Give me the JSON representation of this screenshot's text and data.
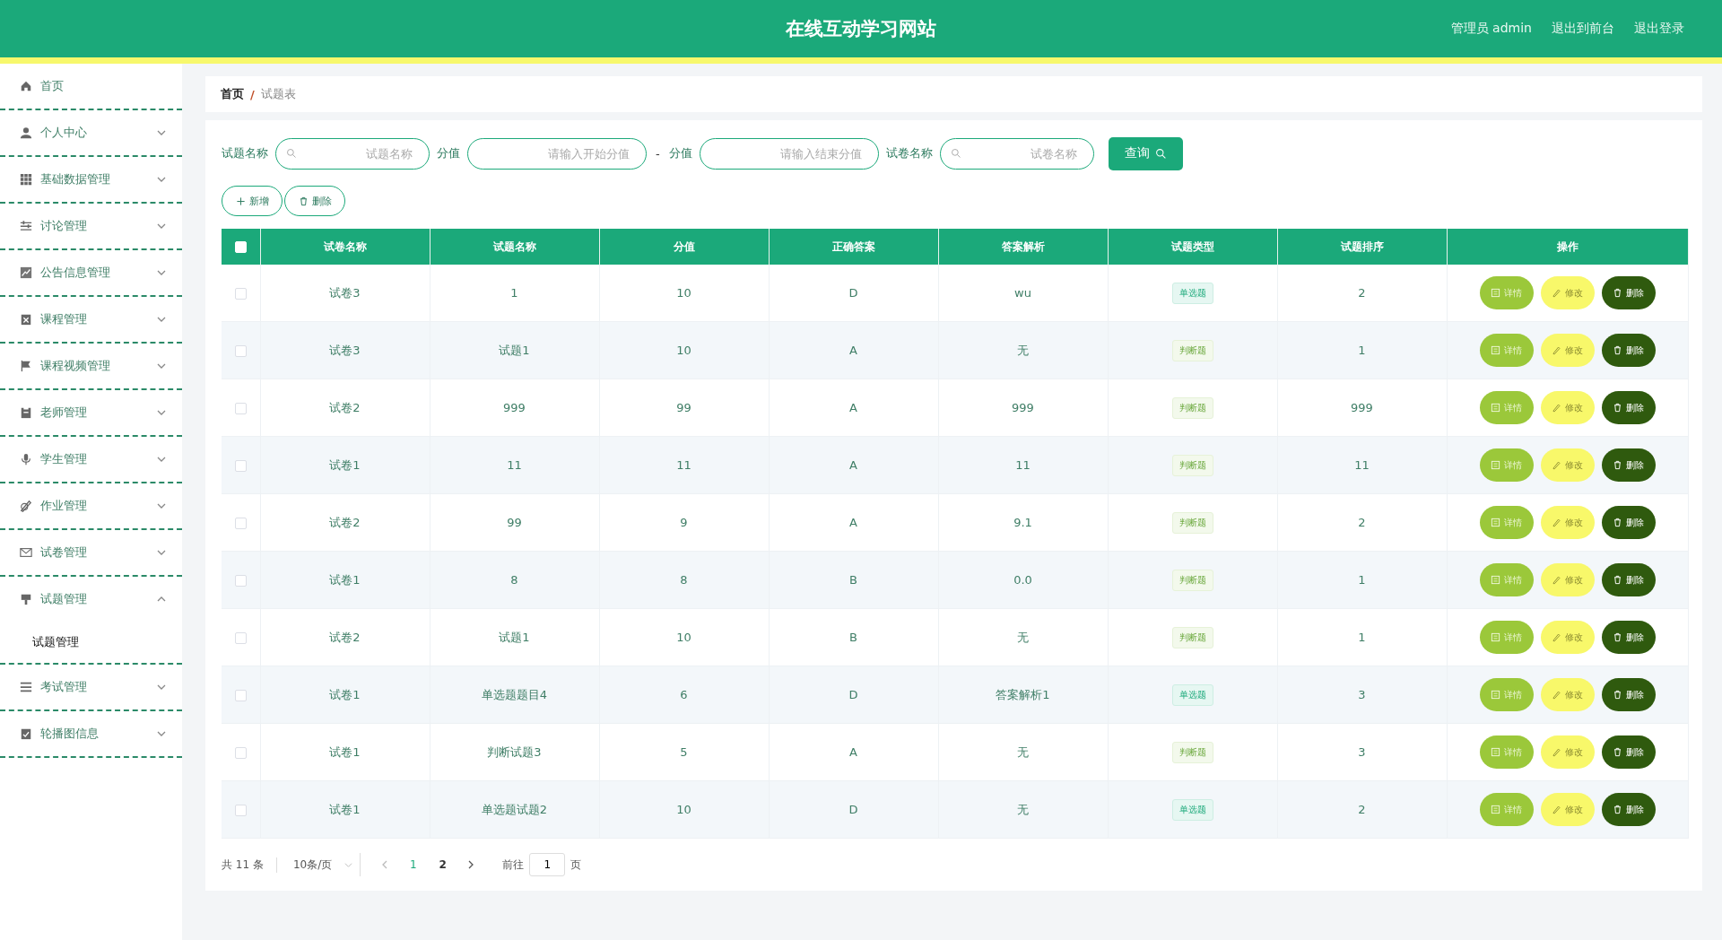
{
  "header": {
    "title": "在线互动学习网站",
    "links": [
      {
        "label": "管理员 admin"
      },
      {
        "label": "退出到前台"
      },
      {
        "label": "退出登录"
      }
    ]
  },
  "sidebar": {
    "items": [
      {
        "kind": "link",
        "label": "首页"
      },
      {
        "kind": "group",
        "label": "个人中心",
        "expanded": false
      },
      {
        "kind": "group",
        "label": "基础数据管理",
        "expanded": false
      },
      {
        "kind": "group",
        "label": "讨论管理",
        "expanded": false
      },
      {
        "kind": "group",
        "label": "公告信息管理",
        "expanded": false
      },
      {
        "kind": "group",
        "label": "课程管理",
        "expanded": false
      },
      {
        "kind": "group",
        "label": "课程视频管理",
        "expanded": false
      },
      {
        "kind": "group",
        "label": "老师管理",
        "expanded": false
      },
      {
        "kind": "group",
        "label": "学生管理",
        "expanded": false
      },
      {
        "kind": "group",
        "label": "作业管理",
        "expanded": false
      },
      {
        "kind": "group",
        "label": "试卷管理",
        "expanded": false
      },
      {
        "kind": "group",
        "label": "试题管理",
        "expanded": true,
        "children": [
          {
            "label": "试题管理",
            "selected": true
          }
        ]
      },
      {
        "kind": "group",
        "label": "考试管理",
        "expanded": false
      },
      {
        "kind": "group",
        "label": "轮播图信息",
        "expanded": false
      }
    ]
  },
  "breadcrumb": [
    {
      "label": "首页"
    },
    {
      "label": "试题表"
    }
  ],
  "breadcrumb_separator": "/",
  "filters": [
    {
      "kind": "search",
      "label": "试题名称",
      "placeholder": "试题名称"
    },
    {
      "kind": "plain",
      "label": "分值",
      "placeholder": "请输入开始分值"
    },
    {
      "kind": "dash",
      "label": "-"
    },
    {
      "kind": "plain",
      "label": "分值",
      "placeholder": "请输入结束分值"
    },
    {
      "kind": "search",
      "label": "试卷名称",
      "placeholder": "试卷名称"
    }
  ],
  "query_button": "查询",
  "toolbar": [
    {
      "kind": "add",
      "label": "新增"
    },
    {
      "kind": "delete",
      "label": "删除"
    }
  ],
  "table": {
    "header_checked": false,
    "columns": [
      "试卷名称",
      "试题名称",
      "分值",
      "正确答案",
      "答案解析",
      "试题类型",
      "试题排序",
      "操作"
    ],
    "rows": [
      {
        "checked": false,
        "cells": [
          "试卷3",
          "1",
          "10",
          "D",
          "wu"
        ],
        "type": {
          "kind": "single",
          "label": "单选题"
        },
        "order": "2",
        "actions": [
          {
            "kind": "detail",
            "label": "详情"
          },
          {
            "kind": "edit",
            "label": "修改"
          },
          {
            "kind": "delete",
            "label": "删除"
          }
        ]
      },
      {
        "checked": false,
        "cells": [
          "试卷3",
          "试题1",
          "10",
          "A",
          "无"
        ],
        "type": {
          "kind": "judge",
          "label": "判断题"
        },
        "order": "1",
        "actions": [
          {
            "kind": "detail",
            "label": "详情"
          },
          {
            "kind": "edit",
            "label": "修改"
          },
          {
            "kind": "delete",
            "label": "删除"
          }
        ]
      },
      {
        "checked": false,
        "cells": [
          "试卷2",
          "999",
          "99",
          "A",
          "999"
        ],
        "type": {
          "kind": "judge",
          "label": "判断题"
        },
        "order": "999",
        "actions": [
          {
            "kind": "detail",
            "label": "详情"
          },
          {
            "kind": "edit",
            "label": "修改"
          },
          {
            "kind": "delete",
            "label": "删除"
          }
        ]
      },
      {
        "checked": false,
        "cells": [
          "试卷1",
          "11",
          "11",
          "A",
          "11"
        ],
        "type": {
          "kind": "judge",
          "label": "判断题"
        },
        "order": "11",
        "actions": [
          {
            "kind": "detail",
            "label": "详情"
          },
          {
            "kind": "edit",
            "label": "修改"
          },
          {
            "kind": "delete",
            "label": "删除"
          }
        ]
      },
      {
        "checked": false,
        "cells": [
          "试卷2",
          "99",
          "9",
          "A",
          "9.1"
        ],
        "type": {
          "kind": "judge",
          "label": "判断题"
        },
        "order": "2",
        "actions": [
          {
            "kind": "detail",
            "label": "详情"
          },
          {
            "kind": "edit",
            "label": "修改"
          },
          {
            "kind": "delete",
            "label": "删除"
          }
        ]
      },
      {
        "checked": false,
        "cells": [
          "试卷1",
          "8",
          "8",
          "B",
          "0.0"
        ],
        "type": {
          "kind": "judge",
          "label": "判断题"
        },
        "order": "1",
        "actions": [
          {
            "kind": "detail",
            "label": "详情"
          },
          {
            "kind": "edit",
            "label": "修改"
          },
          {
            "kind": "delete",
            "label": "删除"
          }
        ]
      },
      {
        "checked": false,
        "cells": [
          "试卷2",
          "试题1",
          "10",
          "B",
          "无"
        ],
        "type": {
          "kind": "judge",
          "label": "判断题"
        },
        "order": "1",
        "actions": [
          {
            "kind": "detail",
            "label": "详情"
          },
          {
            "kind": "edit",
            "label": "修改"
          },
          {
            "kind": "delete",
            "label": "删除"
          }
        ]
      },
      {
        "checked": false,
        "cells": [
          "试卷1",
          "单选题题目4",
          "6",
          "D",
          "答案解析1"
        ],
        "type": {
          "kind": "single",
          "label": "单选题"
        },
        "order": "3",
        "actions": [
          {
            "kind": "detail",
            "label": "详情"
          },
          {
            "kind": "edit",
            "label": "修改"
          },
          {
            "kind": "delete",
            "label": "删除"
          }
        ]
      },
      {
        "checked": false,
        "cells": [
          "试卷1",
          "判断试题3",
          "5",
          "A",
          "无"
        ],
        "type": {
          "kind": "judge",
          "label": "判断题"
        },
        "order": "3",
        "actions": [
          {
            "kind": "detail",
            "label": "详情"
          },
          {
            "kind": "edit",
            "label": "修改"
          },
          {
            "kind": "delete",
            "label": "删除"
          }
        ]
      },
      {
        "checked": false,
        "cells": [
          "试卷1",
          "单选题试题2",
          "10",
          "D",
          "无"
        ],
        "type": {
          "kind": "single",
          "label": "单选题"
        },
        "order": "2",
        "actions": [
          {
            "kind": "detail",
            "label": "详情"
          },
          {
            "kind": "edit",
            "label": "修改"
          },
          {
            "kind": "delete",
            "label": "删除"
          }
        ]
      }
    ]
  },
  "pagination": {
    "total": "共 11 条",
    "page_size": "10条/页",
    "pages": [
      {
        "label": "1",
        "selected": true
      },
      {
        "label": "2",
        "selected": false
      }
    ],
    "goto_label": "前往",
    "goto_value": "1",
    "goto_suffix": "页"
  }
}
